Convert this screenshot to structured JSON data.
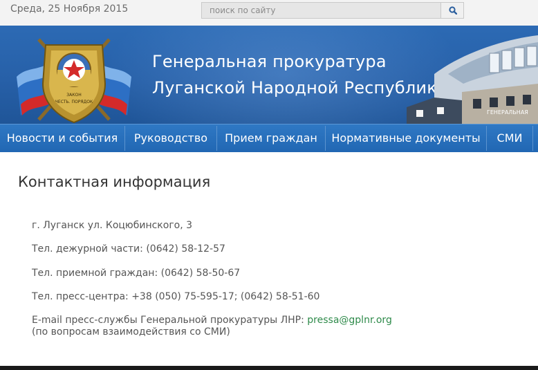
{
  "topbar": {
    "date": "Среда, 25 Ноября 2015",
    "search_placeholder": "поиск по сайту"
  },
  "header": {
    "title_line1": "Генеральная прокуратура",
    "title_line2": "Луганской Народной Республики",
    "emblem_text": "ЗАКОН ЧЕСТЬ ПОРЯДОК",
    "building_sign": "ГЕНЕРАЛЬНАЯ"
  },
  "nav": {
    "items": [
      {
        "label": "Новости и события"
      },
      {
        "label": "Руководство"
      },
      {
        "label": "Прием граждан"
      },
      {
        "label": "Нормативные документы"
      },
      {
        "label": "СМИ"
      }
    ]
  },
  "content": {
    "title": "Контактная информация",
    "address": "г. Луганск ул. Коцюбинского, 3",
    "duty_phone": "Тел. дежурной части: (0642) 58-12-57",
    "reception_phone": "Тел. приемной граждан: (0642) 58-50-67",
    "press_phone": "Тел. пресс-центра: +38 (050) 75-595-17; (0642) 58-51-60",
    "email_label": "E-mail пресс-службы Генеральной прокуратуры ЛНР:",
    "email": "pressa@gplnr.org",
    "email_note": "(по вопросам взаимодействия со СМИ)"
  },
  "colors": {
    "banner_blue": "#2a66b0",
    "nav_blue": "#2167b3",
    "link_green": "#2e8a4a",
    "flag_blue": "#2d6fc4",
    "flag_red": "#d42a2a"
  }
}
